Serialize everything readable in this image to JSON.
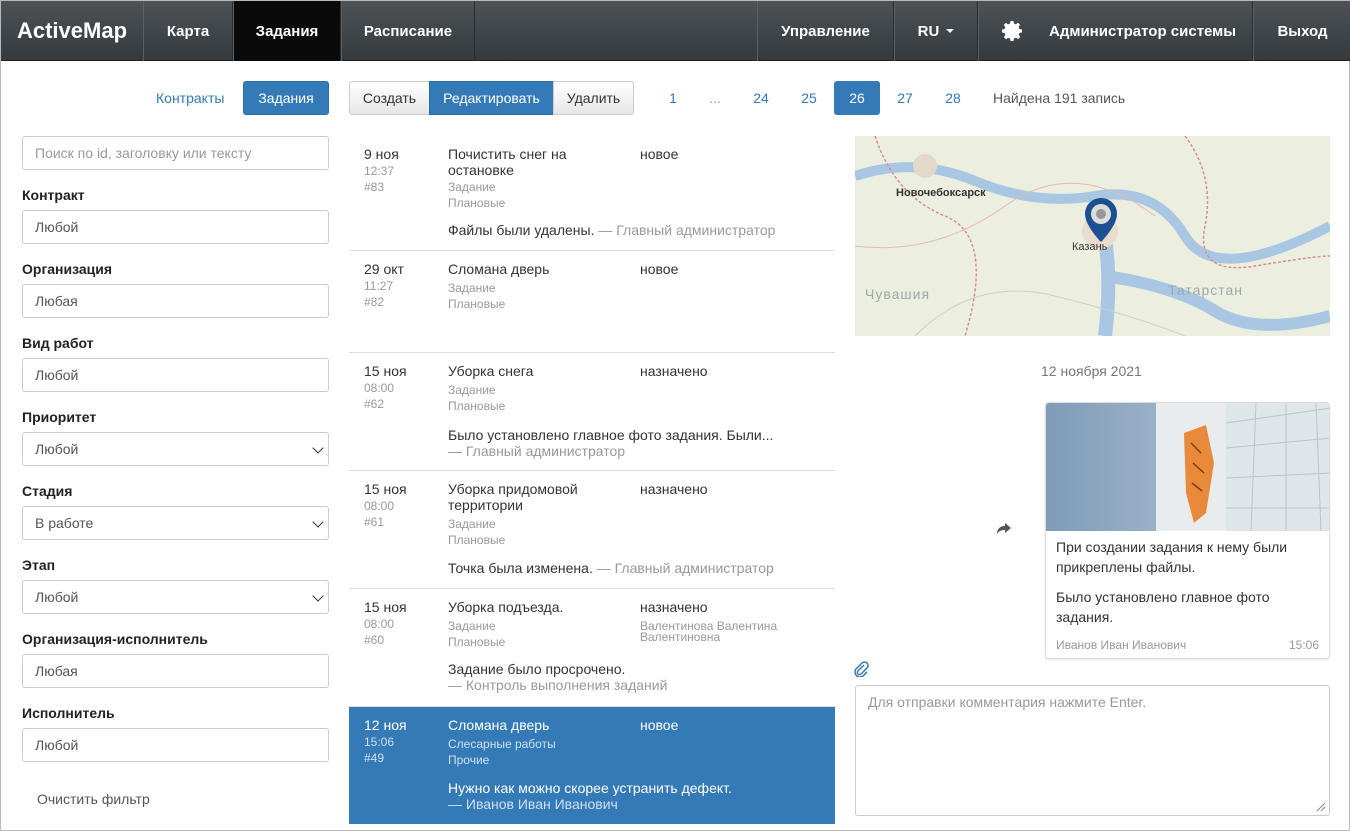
{
  "nav": {
    "brand": "ActiveMap",
    "items": [
      "Карта",
      "Задания",
      "Расписание"
    ],
    "right": {
      "manage": "Управление",
      "lang": "RU",
      "user": "Администратор системы",
      "logout": "Выход"
    }
  },
  "toolbar": {
    "contracts": "Контракты",
    "tasks": "Задания",
    "create": "Создать",
    "edit": "Редактировать",
    "delete": "Удалить"
  },
  "pagination": {
    "pages": [
      "1",
      "...",
      "24",
      "25",
      "26",
      "27",
      "28"
    ],
    "active": "26",
    "found": "Найдена 191 запись"
  },
  "filters": {
    "search_placeholder": "Поиск по id, заголовку или тексту",
    "contract_label": "Контракт",
    "contract_value": "Любой",
    "org_label": "Организация",
    "org_value": "Любая",
    "worktype_label": "Вид работ",
    "worktype_value": "Любой",
    "priority_label": "Приоритет",
    "priority_value": "Любой",
    "stage_label": "Стадия",
    "stage_value": "В работе",
    "step_label": "Этап",
    "step_value": "Любой",
    "executor_org_label": "Организация-исполнитель",
    "executor_org_value": "Любая",
    "executor_label": "Исполнитель",
    "executor_value": "Любой",
    "clear": "Очистить фильтр"
  },
  "tasks": [
    {
      "date": "9 ноя",
      "time": "12:37",
      "num": "#83",
      "title": "Почистить снег на остановке",
      "type": "Задание",
      "cat": "Плановые",
      "status": "новое",
      "msg": "Файлы были удалены.",
      "author": "— Главный администратор"
    },
    {
      "date": "29 окт",
      "time": "11:27",
      "num": "#82",
      "title": "Сломана дверь",
      "type": "Задание",
      "cat": "Плановые",
      "status": "новое"
    },
    {
      "date": "15 ноя",
      "time": "08:00",
      "num": "#62",
      "title": "Уборка снега",
      "type": "Задание",
      "cat": "Плановые",
      "status": "назначено",
      "msg": "Было установлено главное фото задания. Были...",
      "author": "— Главный администратор"
    },
    {
      "date": "15 ноя",
      "time": "08:00",
      "num": "#61",
      "title": "Уборка придомовой территории",
      "type": "Задание",
      "cat": "Плановые",
      "status": "назначено",
      "msg": "Точка была изменена.",
      "author": "— Главный администратор"
    },
    {
      "date": "15 ноя",
      "time": "08:00",
      "num": "#60",
      "title": "Уборка подъезда.",
      "type": "Задание",
      "cat": "Плановые",
      "status": "назначено",
      "assignee": "Валентинова Валентина Валентиновна",
      "msg": "Задание было просрочено.",
      "author": "— Контроль выполнения заданий"
    },
    {
      "date": "12 ноя",
      "time": "15:06",
      "num": "#49",
      "title": "Сломана дверь",
      "type": "Слесарные работы",
      "cat": "Прочие",
      "status": "новое",
      "msg": "Нужно как можно скорее устранить дефект.",
      "author": "— Иванов Иван Иванович"
    }
  ],
  "map": {
    "city1": "Новочебоксарск",
    "city2": "Казань",
    "region1": "Чувашия",
    "region2": "Татарстан"
  },
  "feed": {
    "date": "12 ноября 2021",
    "text1": "При создании задания к нему были прикреплены файлы.",
    "text2": "Было установлено главное фото задания.",
    "author": "Иванов Иван Иванович",
    "time": "15:06"
  },
  "comment": {
    "placeholder": "Для отправки комментария нажмите Enter."
  }
}
